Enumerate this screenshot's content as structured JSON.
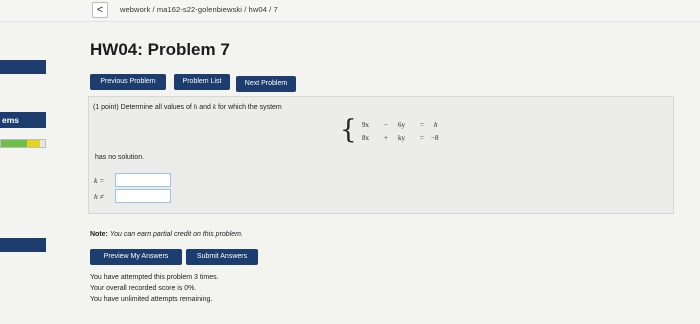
{
  "nav": {
    "back_glyph": "<",
    "breadcrumb": "webwork / ma162-s22-golenbiewski / hw04 / 7"
  },
  "sidebar": {
    "label": "ems",
    "progress": {
      "green_fraction": 0.6,
      "yellow_fraction": 0.28,
      "green_color": "#6cc04a",
      "yellow_color": "#e6d31e"
    }
  },
  "page": {
    "title": "HW04: Problem 7"
  },
  "buttons": {
    "previous_problem": "Previous Problem",
    "problem_list": "Problem List",
    "next_problem": "Next Problem",
    "preview_answers": "Preview My Answers",
    "submit_answers": "Submit Answers"
  },
  "problem": {
    "points": "(1 point)",
    "intro_a": "Determine all values of",
    "var_h": "h",
    "and": "and",
    "var_k": "k",
    "intro_b": "for which the system",
    "system": {
      "row1": {
        "t1": "9x",
        "op1": "−",
        "t2": "6y",
        "eq": "=",
        "rhs": "h"
      },
      "row2": {
        "t1": "8x",
        "op1": "+",
        "t2": "ky",
        "eq": "=",
        "rhs": "−8"
      }
    },
    "conclusion": "has no solution.",
    "k_label": "k =",
    "h_label": "h ≠",
    "k_value": "",
    "h_value": ""
  },
  "note": {
    "prefix": "Note:",
    "text": "You can earn partial credit on this problem."
  },
  "status": {
    "attempts": "You have attempted this problem 3 times.",
    "score": "Your overall recorded score is 0%.",
    "remaining": "You have unlimited attempts remaining."
  },
  "colors": {
    "accent": "#1c3d6e",
    "input_border": "#9ec3e6"
  }
}
